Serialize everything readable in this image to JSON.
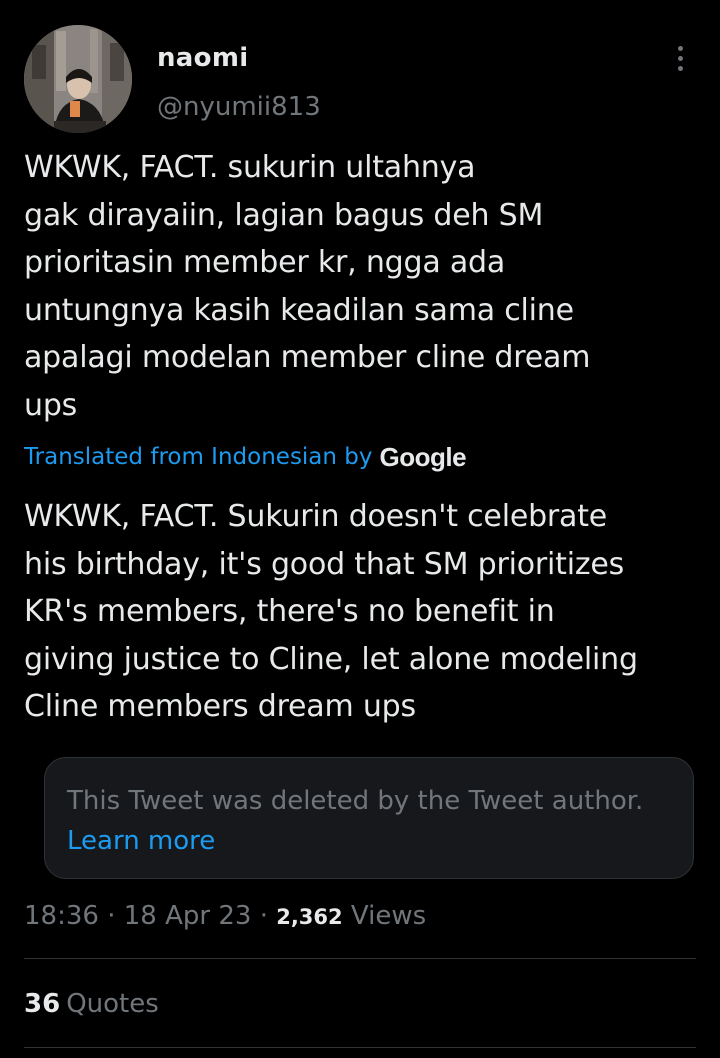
{
  "tweet": {
    "author": {
      "display_name": "naomi",
      "handle": "@nyumii813"
    },
    "original_text": "WKWK, FACT. sukurin ultahnya\ngak dirayaiin, lagian bagus deh SM\nprioritasin member kr, ngga ada\nuntungnya kasih keadilan sama cline\napalagi modelan member cline dream\nups",
    "translation": {
      "label": "Translated from Indonesian by",
      "provider": "Google",
      "text": "WKWK, FACT. Sukurin doesn't celebrate\nhis birthday, it's good that SM prioritizes\nKR's members, there's no benefit in\ngiving justice to Cline, let alone modeling\nCline members dream ups"
    },
    "quoted_tweet": {
      "deleted_message": "This Tweet was deleted by the Tweet author.",
      "learn_more_label": "Learn more"
    },
    "meta": {
      "time": "18:36",
      "separator": "·",
      "date": "18 Apr 23",
      "views_count": "2,362",
      "views_label": "Views"
    },
    "engagement": {
      "quotes_count": "36",
      "quotes_label": "Quotes"
    }
  },
  "icons": {
    "more": "more-vertical-icon"
  },
  "colors": {
    "background": "#000000",
    "text_primary": "#e7e9ea",
    "text_secondary": "#71767b",
    "accent": "#1d9bf0",
    "border": "#2f3336"
  }
}
